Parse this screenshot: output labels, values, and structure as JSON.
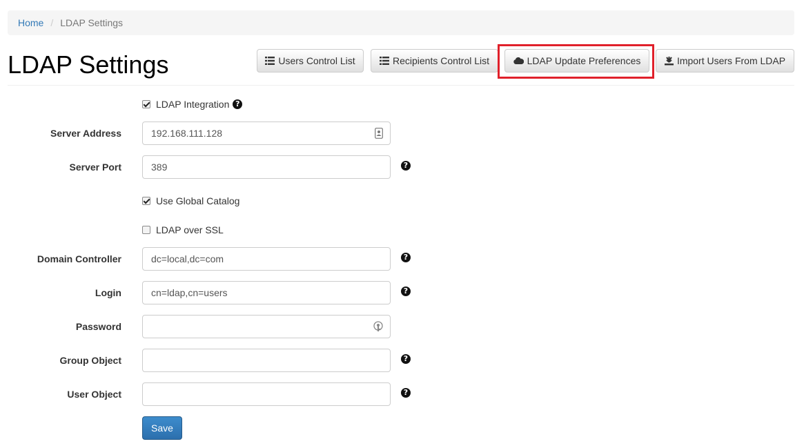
{
  "breadcrumb": {
    "home": "Home",
    "separator": "/",
    "current": "LDAP Settings"
  },
  "page": {
    "title": "LDAP Settings"
  },
  "toolbar": {
    "users_control_list": "Users Control List",
    "recipients_control_list": "Recipients Control List",
    "ldap_update_preferences": "LDAP Update Preferences",
    "import_users_from_ldap": "Import Users From LDAP",
    "highlight_color": "#e0202a"
  },
  "form": {
    "ldap_integration": {
      "label": "LDAP Integration",
      "checked": true
    },
    "server_address": {
      "label": "Server Address",
      "value": "192.168.111.128"
    },
    "server_port": {
      "label": "Server Port",
      "value": "389"
    },
    "use_global_catalog": {
      "label": "Use Global Catalog",
      "checked": true
    },
    "ldap_over_ssl": {
      "label": "LDAP over SSL",
      "checked": false
    },
    "domain_controller": {
      "label": "Domain Controller",
      "value": "dc=local,dc=com"
    },
    "login": {
      "label": "Login",
      "value": "cn=ldap,cn=users"
    },
    "password": {
      "label": "Password",
      "value": ""
    },
    "group_object": {
      "label": "Group Object",
      "value": ""
    },
    "user_object": {
      "label": "User Object",
      "value": ""
    },
    "help_glyph": "?",
    "save_label": "Save"
  },
  "colors": {
    "link": "#337ab7",
    "primary": "#337ab7"
  }
}
